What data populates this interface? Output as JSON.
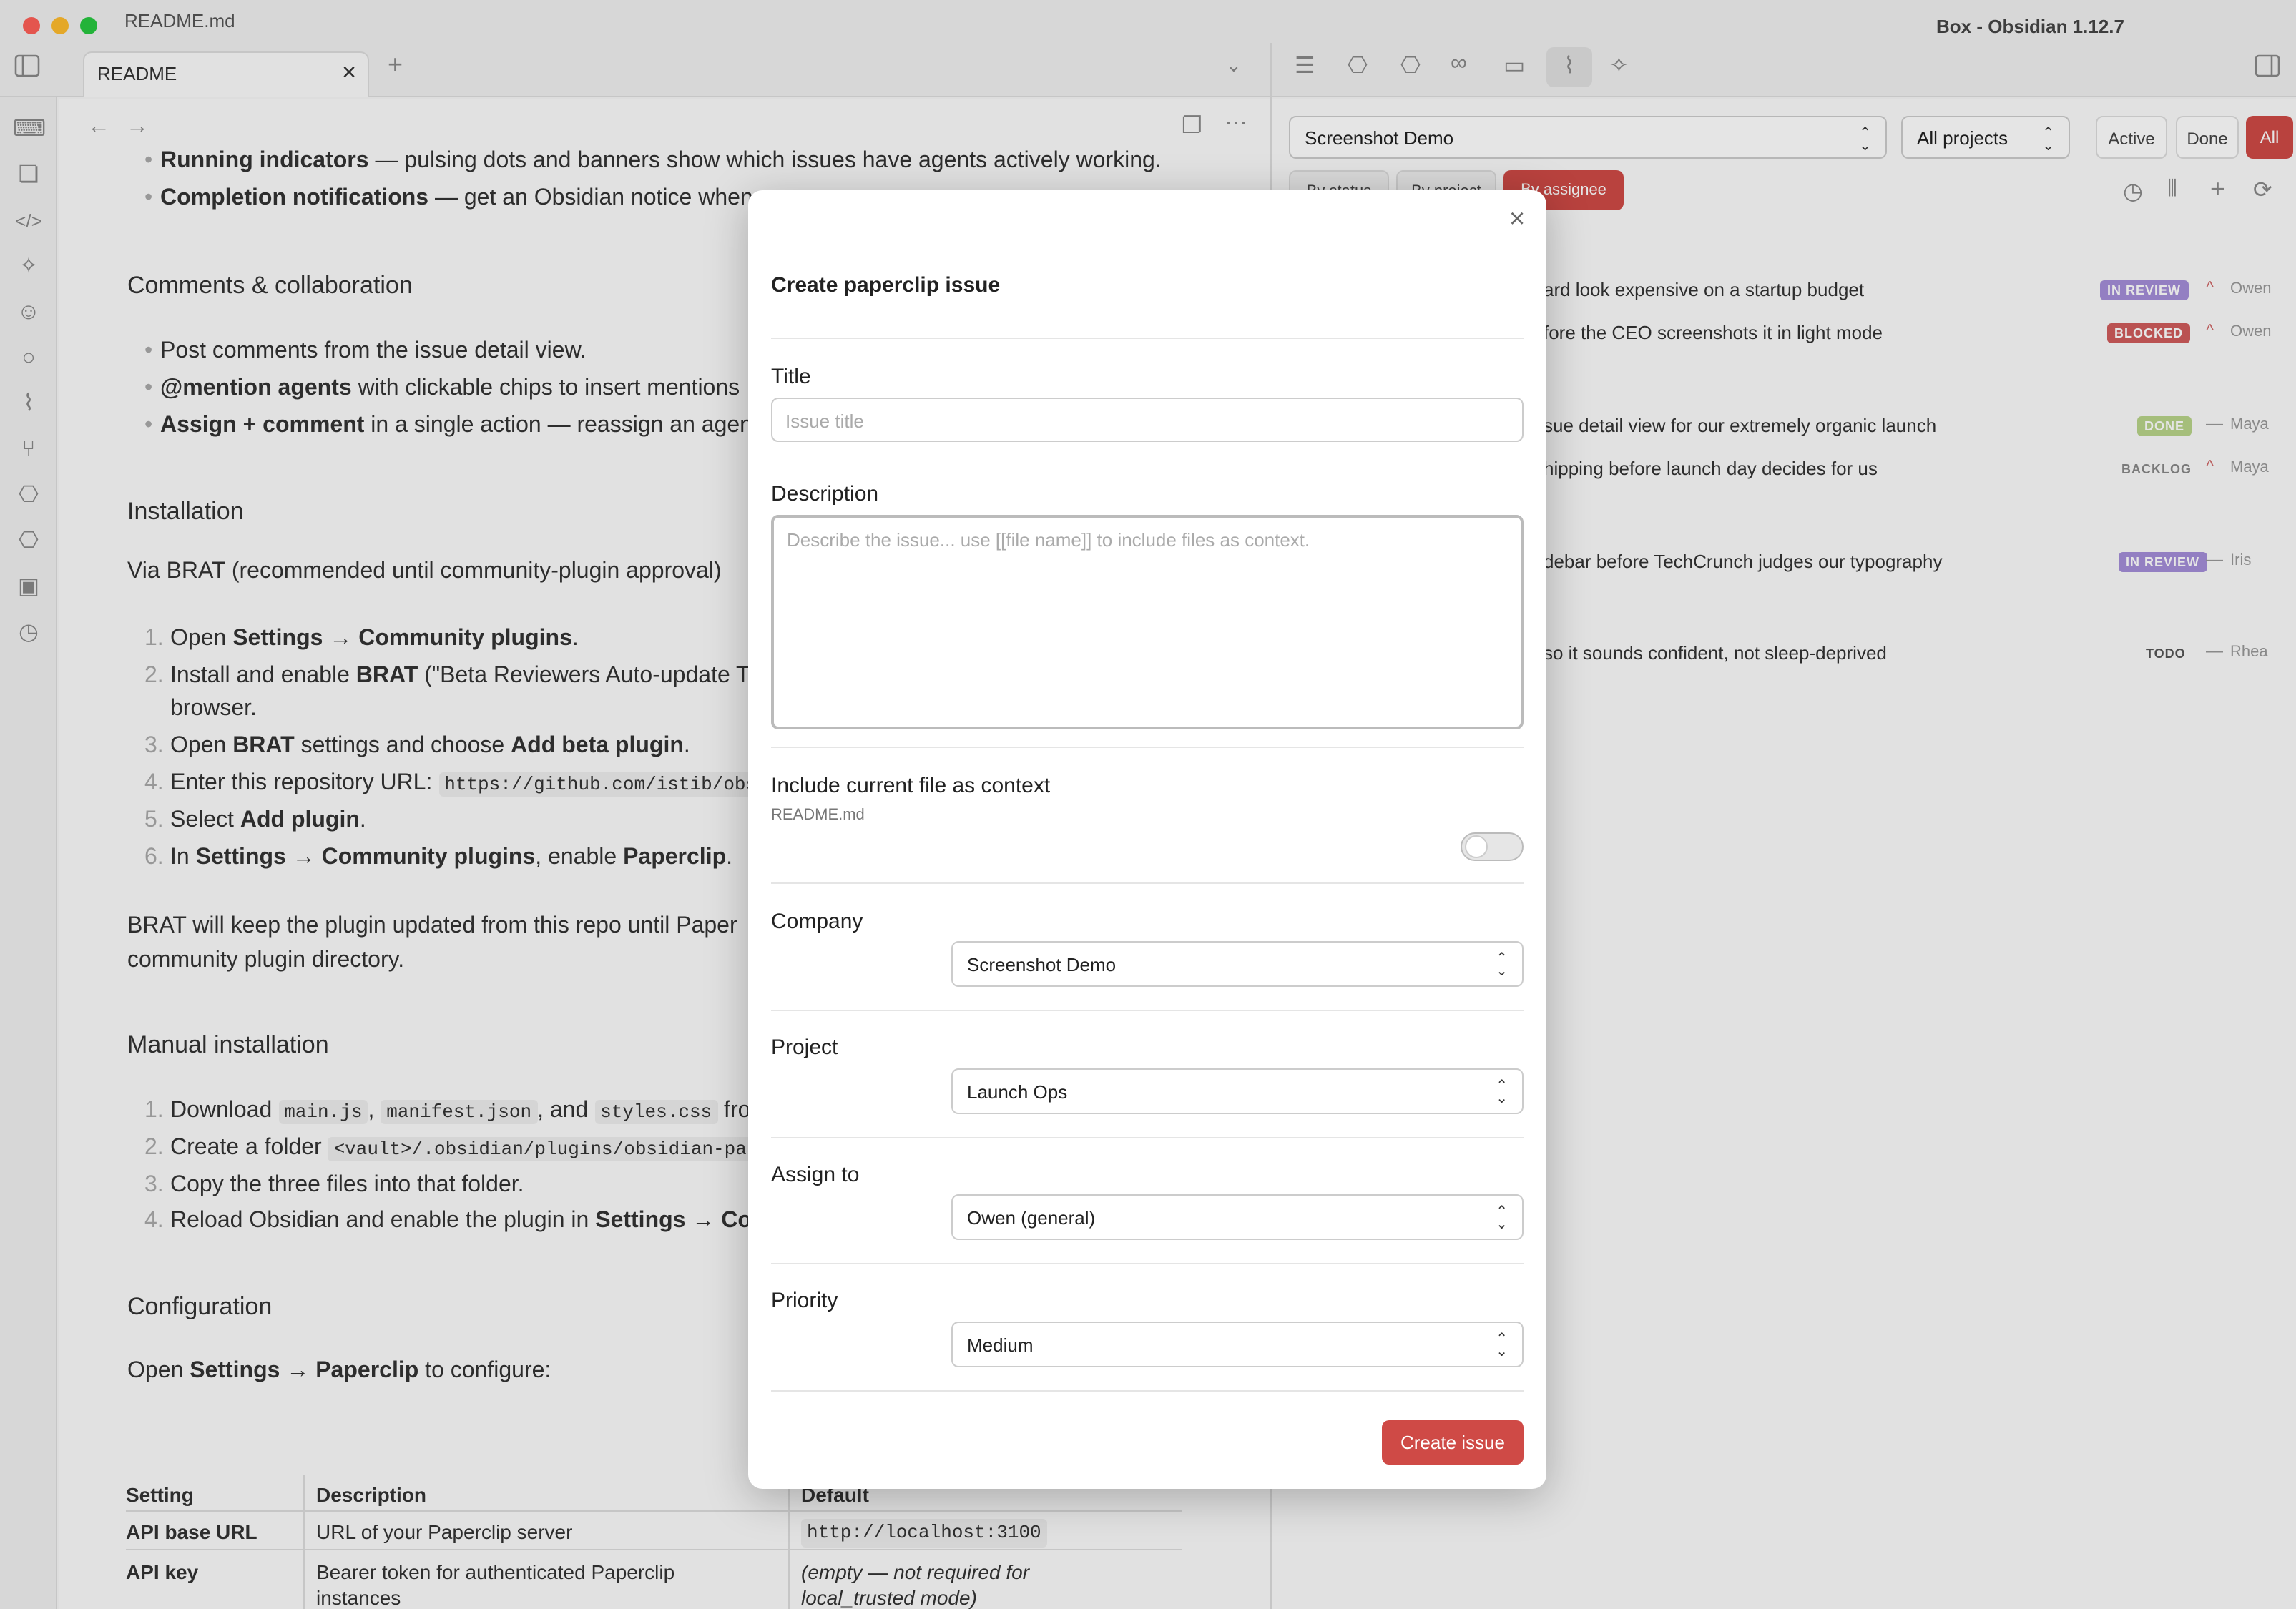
{
  "window": {
    "file_title": "README.md",
    "app_title": "Box - Obsidian 1.12.7"
  },
  "tab": {
    "label": "README"
  },
  "editor": {
    "lines": {
      "running_b": "Running indicators",
      "running_t": " — pulsing dots and banners show which issues have agents actively working.",
      "completion_b": "Completion notifications",
      "completion_t": " — get an Obsidian notice when",
      "comments_h": "Comments & collaboration",
      "post": "Post comments from the issue detail view.",
      "mention_b": "@mention agents",
      "mention_t": " with clickable chips to insert mentions",
      "assign_b": "Assign + comment",
      "assign_t": " in a single action — reassign an agen",
      "install_h": "Installation",
      "brat": "Via BRAT (recommended until community-plugin approval)",
      "s1a": "Open ",
      "s1b": "Settings → Community plugins",
      "s1c": ".",
      "s2a": "Install and enable ",
      "s2b": "BRAT",
      "s2c": " (\"Beta Reviewers Auto-update T",
      "s2d": "browser.",
      "s3a": "Open ",
      "s3b": "BRAT",
      "s3c": " settings and choose ",
      "s3d": "Add beta plugin",
      "s3e": ".",
      "s4a": "Enter this repository URL: ",
      "s4b": "https://github.com/istib/obsidian-pa",
      "s5a": "Select ",
      "s5b": "Add plugin",
      "s5c": ".",
      "s6a": "In ",
      "s6b": "Settings → Community plugins",
      "s6c": ", enable ",
      "s6d": "Paperclip",
      "s6e": ".",
      "keep1": "BRAT will keep the plugin updated from this repo until Paper",
      "keep2": "community plugin directory.",
      "manual_h": "Manual installation",
      "m1a": "Download ",
      "m1b": "main.js",
      "m1c": ", ",
      "m1d": "manifest.json",
      "m1e": ", and ",
      "m1f": "styles.css",
      "m1g": " from the",
      "m2a": "Create a folder ",
      "m2b": "<vault>/.obsidian/plugins/obsidian-paperclip/",
      "m2c": " .",
      "m3": "Copy the three files into that folder.",
      "m4a": "Reload Obsidian and enable the plugin in ",
      "m4b": "Settings → Co",
      "config_h": "Configuration",
      "open_a": "Open ",
      "open_b": "Settings → Paperclip",
      "open_c": " to configure:"
    },
    "table": {
      "headers": [
        "Setting",
        "Description",
        "Default"
      ],
      "rows": [
        [
          "API base URL",
          "URL of your Paperclip server",
          "http://localhost:3100"
        ],
        [
          "API key",
          "Bearer token for authenticated Paperclip",
          "(empty — not required for"
        ]
      ],
      "row2_desc2": "instances",
      "row2_default2": "local_trusted mode)"
    }
  },
  "panel": {
    "company_select": "Screenshot Demo",
    "project_select": "All projects",
    "filters": [
      "Active",
      "Done",
      "All"
    ],
    "groupings": [
      "By status",
      "By project",
      "By assignee"
    ],
    "issues": [
      {
        "title": "ard look expensive on a startup budget",
        "status": "IN REVIEW",
        "assignee": "Owen",
        "priority": "^"
      },
      {
        "title": "fore the CEO screenshots it in light mode",
        "status": "BLOCKED",
        "assignee": "Owen",
        "priority": "^"
      },
      {
        "title": "sue detail view for our extremely organic launch",
        "status": "DONE",
        "assignee": "Maya",
        "priority": "—"
      },
      {
        "title": "hipping before launch day decides for us",
        "status": "BACKLOG",
        "assignee": "Maya",
        "priority": "^"
      },
      {
        "title": "debar before TechCrunch judges our typography",
        "status": "IN REVIEW",
        "assignee": "Iris",
        "priority": "—"
      },
      {
        "title": " so it sounds confident, not sleep-deprived",
        "status": "TODO",
        "assignee": "Rhea",
        "priority": "—"
      }
    ]
  },
  "modal": {
    "heading": "Create paperclip issue",
    "title_label": "Title",
    "title_placeholder": "Issue title",
    "description_label": "Description",
    "description_placeholder": "Describe the issue... use [[file name]] to include files as context.",
    "context_label": "Include current file as context",
    "context_file": "README.md",
    "context_enabled": false,
    "company_label": "Company",
    "company_value": "Screenshot Demo",
    "project_label": "Project",
    "project_value": "Launch Ops",
    "assign_label": "Assign to",
    "assign_value": "Owen (general)",
    "priority_label": "Priority",
    "priority_value": "Medium",
    "submit_label": "Create issue"
  },
  "colors": {
    "accent": "#cf4a46",
    "in_review": "#a48ed8",
    "blocked": "#d05c5c",
    "done": "#b8d48a",
    "priority_high": "#d06a6a"
  }
}
